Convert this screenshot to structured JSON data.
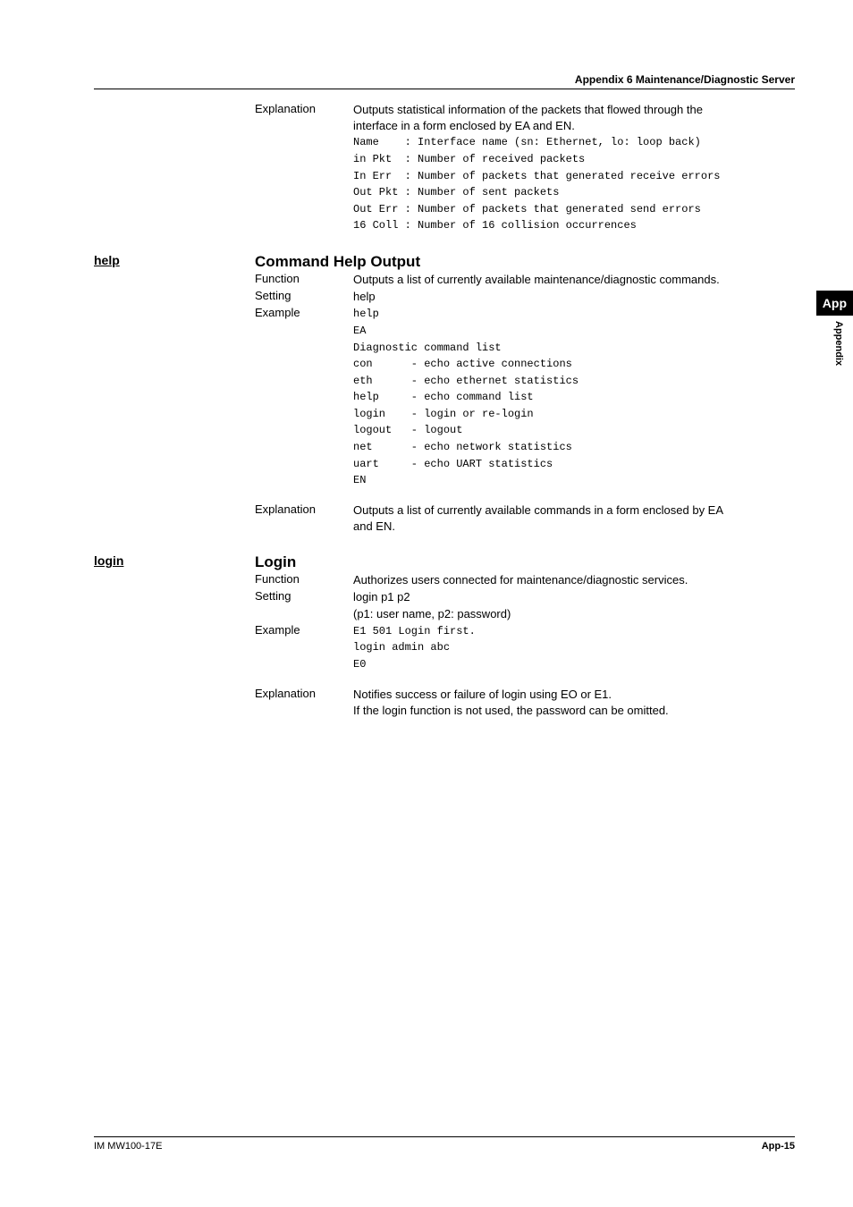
{
  "header": {
    "title": "Appendix 6  Maintenance/Diagnostic Server"
  },
  "block1": {
    "k1": "Explanation",
    "v1a": "Outputs statistical information of the packets that flowed through the",
    "v1b": "interface in a form enclosed by EA and EN.",
    "m1": "Name    : Interface name (sn: Ethernet, lo: loop back)",
    "m2": "in Pkt  : Number of received packets",
    "m3": "In Err  : Number of packets that generated receive errors",
    "m4": "Out Pkt : Number of sent packets",
    "m5": "Out Err : Number of packets that generated send errors",
    "m6": "16 Coll : Number of 16 collision occurrences"
  },
  "help": {
    "cmd": "help",
    "title": "Command Help Output",
    "r1k": "Function",
    "r1v": "Outputs a list of currently available maintenance/diagnostic commands.",
    "r2k": "Setting",
    "r2v": "help",
    "r3k": "Example",
    "m1": "help",
    "m2": "EA",
    "m3": "Diagnostic command list",
    "m4": "",
    "m5": "con      - echo active connections",
    "m6": "eth      - echo ethernet statistics",
    "m7": "help     - echo command list",
    "m8": "login    - login or re-login",
    "m9": "logout   - logout",
    "m10": "net      - echo network statistics",
    "m11": "uart     - echo UART statistics",
    "m12": "EN",
    "ek": "Explanation",
    "ev1": "Outputs a list of currently available commands in a form enclosed by EA",
    "ev2": "and EN."
  },
  "login": {
    "cmd": "login",
    "title": "Login",
    "r1k": "Function",
    "r1v": "Authorizes users connected for maintenance/diagnostic services.",
    "r2k": "Setting",
    "r2v": "login p1 p2",
    "r2v2": "(p1: user name, p2: password)",
    "r3k": "Example",
    "m1": "E1 501 Login first.",
    "m2": "login admin abc",
    "m3": "E0",
    "ek": "Explanation",
    "ev1": "Notifies success or failure of login using EO or E1.",
    "ev2": "If the login function is not used, the password can be omitted."
  },
  "tab": {
    "box": "App",
    "text": "Appendix"
  },
  "footer": {
    "left": "IM MW100-17E",
    "right": "App-15"
  }
}
